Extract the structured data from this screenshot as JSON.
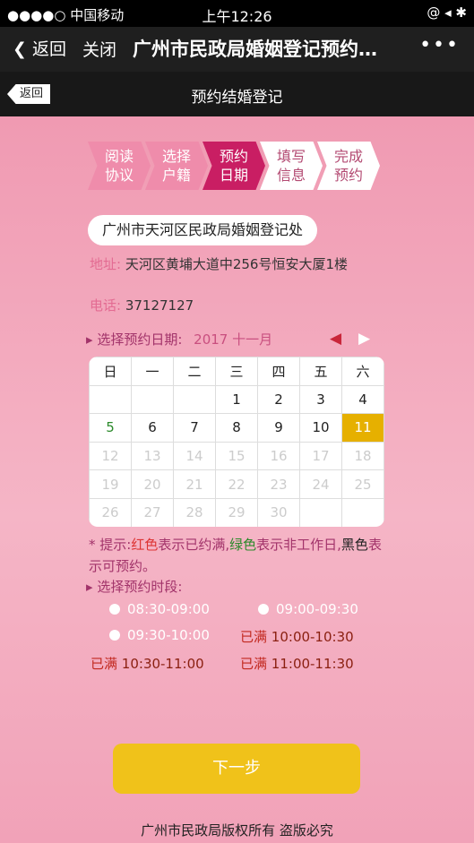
{
  "statusbar": {
    "carrier": "●●●●○ 中国移动",
    "time": "上午12:26",
    "icons": "@ ◂ ✱"
  },
  "navbar": {
    "back_label": "返回",
    "close_label": "关闭",
    "title": "广州市民政局婚姻登记预约…",
    "more": "•••"
  },
  "subbar": {
    "back_label": "返回",
    "title": "预约结婚登记"
  },
  "steps": [
    {
      "l1": "阅读",
      "l2": "协议"
    },
    {
      "l1": "选择",
      "l2": "户籍"
    },
    {
      "l1": "预约",
      "l2": "日期"
    },
    {
      "l1": "填写",
      "l2": "信息"
    },
    {
      "l1": "完成",
      "l2": "预约"
    }
  ],
  "office": {
    "name": "广州市天河区民政局婚姻登记处",
    "addr_label": "地址:",
    "addr": "天河区黄埔大道中256号恒安大厦1楼",
    "phone_label": "电话:",
    "phone": "37127127"
  },
  "date": {
    "label": "选择预约日期:",
    "month": "2017 十一月",
    "prev": "◀",
    "next": "▶"
  },
  "calendar": {
    "weekdays": [
      "日",
      "一",
      "二",
      "三",
      "四",
      "五",
      "六"
    ],
    "rows": [
      [
        "",
        "",
        "",
        "1",
        "2",
        "3",
        "4"
      ],
      [
        "5",
        "6",
        "7",
        "8",
        "9",
        "10",
        "11"
      ],
      [
        "12",
        "13",
        "14",
        "15",
        "16",
        "17",
        "18"
      ],
      [
        "19",
        "20",
        "21",
        "22",
        "23",
        "24",
        "25"
      ],
      [
        "26",
        "27",
        "28",
        "29",
        "30",
        "",
        ""
      ]
    ]
  },
  "tip": {
    "prefix": "* 提示:",
    "red": "红色",
    "t1": "表示已约满,",
    "green": "绿色",
    "t2": "表示非工作日,",
    "black": "黑色",
    "t3": "表示可预约。"
  },
  "period": {
    "label": "选择预约时段:"
  },
  "slots": [
    {
      "time": "08:30-09:00",
      "status": ""
    },
    {
      "time": "09:00-09:30",
      "status": ""
    },
    {
      "time": "09:30-10:00",
      "status": ""
    },
    {
      "time": "10:00-10:30",
      "status": "已满"
    },
    {
      "time": "10:30-11:00",
      "status": "已满"
    },
    {
      "time": "11:00-11:30",
      "status": "已满"
    }
  ],
  "next_button": "下一步",
  "footer": "广州市民政局版权所有 盗版必究",
  "colors": {
    "accent": "#c91e63",
    "button": "#f0c21a",
    "selected": "#e6b000"
  }
}
